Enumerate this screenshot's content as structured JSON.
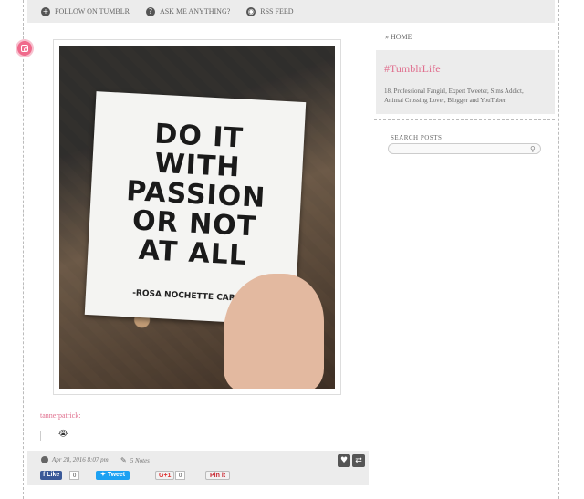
{
  "topnav": {
    "follow_label": "FOLLOW ON TUMBLR",
    "ask_label": "ASK ME ANYTHING?",
    "rss_label": "RSS FEED"
  },
  "post": {
    "type_icon": "camera-icon",
    "photo": {
      "quote_lines": [
        "DO IT",
        "WITH",
        "PASSION",
        "OR NOT",
        "AT ALL"
      ],
      "author": "-ROSA NOCHETTE CAREY-"
    },
    "source_link": "tannerpatrick:",
    "emoji": "😭",
    "date": "Apr 28, 2016 8:07 pm",
    "notes": "5 Notes",
    "like_icon": "heart-icon",
    "reblog_icon": "reblog-icon"
  },
  "share": {
    "facebook_label": "Like",
    "facebook_count": "0",
    "twitter_label": "Tweet",
    "gplus_label": "G+1",
    "gplus_count": "0",
    "pinterest_label": "Pin it"
  },
  "sidebar": {
    "home_label": "HOME",
    "blog_title": "#TumblrLife",
    "bio": "18, Professional Fangirl, Expert Tweeter, Sims Addict, Animal Crossing Lover, Blogger and YouTuber",
    "search_label": "SEARCH POSTS",
    "search_value": ""
  },
  "colors": {
    "accent": "#e0708f",
    "badge": "#f06a8c",
    "panel": "#ececec"
  }
}
